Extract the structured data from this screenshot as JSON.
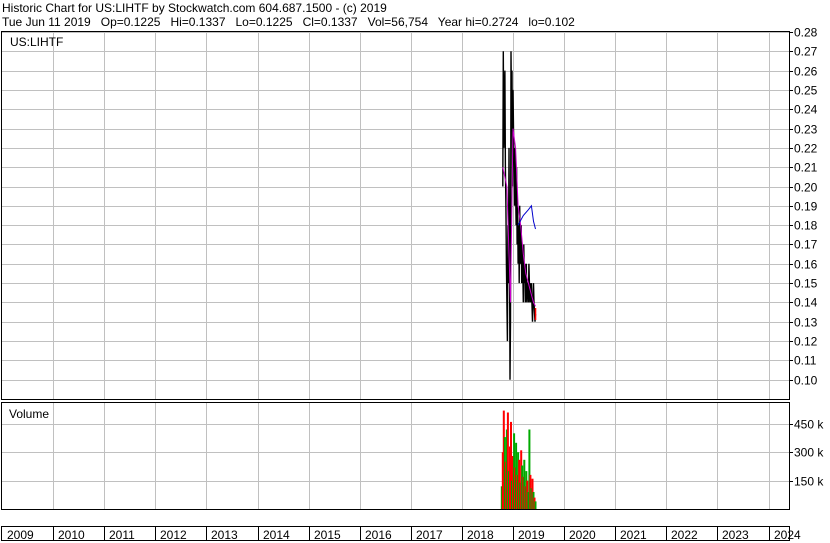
{
  "header": {
    "line1": "Historic Chart for US:LIHTF by Stockwatch.com 604.687.1500 - (c) 2019",
    "line2": "Tue Jun 11 2019   Op=0.1225   Hi=0.1337   Lo=0.1225   Cl=0.1337   Vol=56,754   Year hi=0.2724   lo=0.102"
  },
  "colors": {
    "price": "#000000",
    "ma_fast": "#cc00cc",
    "ma_slow": "#0000cc",
    "vol_up": "#00aa00",
    "vol_down": "#ff0000",
    "grid": "#c0c0c0"
  },
  "chart_data": [
    {
      "type": "line",
      "title": "US:LIHTF",
      "ylim": [
        0.09,
        0.28
      ],
      "y_ticks": [
        "0.28",
        "0.27",
        "0.26",
        "0.25",
        "0.24",
        "0.23",
        "0.22",
        "0.21",
        "0.20",
        "0.19",
        "0.18",
        "0.17",
        "0.16",
        "0.15",
        "0.14",
        "0.13",
        "0.12",
        "0.11",
        "0.10"
      ],
      "x_ticks": [
        "2009",
        "2010",
        "2011",
        "2012",
        "2013",
        "2014",
        "2015",
        "2016",
        "2017",
        "2018",
        "2019",
        "2020",
        "2021",
        "2022",
        "2023",
        "2024"
      ],
      "xlim": [
        2009.0,
        2024.4
      ],
      "series": [
        {
          "role": "price",
          "x": [
            2018.8,
            2018.81,
            2018.82,
            2018.83,
            2018.84,
            2018.85,
            2018.86,
            2018.87,
            2018.88,
            2018.89,
            2018.9,
            2018.91,
            2018.92,
            2018.93,
            2018.94,
            2018.95,
            2018.96,
            2018.97,
            2018.98,
            2018.99,
            2019.0,
            2019.01,
            2019.02,
            2019.03,
            2019.04,
            2019.05,
            2019.06,
            2019.07,
            2019.08,
            2019.09,
            2019.1,
            2019.11,
            2019.12,
            2019.13,
            2019.14,
            2019.15,
            2019.16,
            2019.17,
            2019.18,
            2019.19,
            2019.2,
            2019.21,
            2019.22,
            2019.23,
            2019.24,
            2019.25,
            2019.26,
            2019.27,
            2019.28,
            2019.29,
            2019.3,
            2019.31,
            2019.32,
            2019.33,
            2019.34,
            2019.35,
            2019.36,
            2019.37,
            2019.38,
            2019.39,
            2019.4,
            2019.41,
            2019.42,
            2019.43,
            2019.44
          ],
          "values": [
            0.2,
            0.27,
            0.22,
            0.24,
            0.26,
            0.21,
            0.19,
            0.16,
            0.14,
            0.12,
            0.18,
            0.15,
            0.22,
            0.17,
            0.1,
            0.13,
            0.27,
            0.24,
            0.26,
            0.2,
            0.25,
            0.23,
            0.21,
            0.19,
            0.22,
            0.2,
            0.18,
            0.21,
            0.17,
            0.19,
            0.16,
            0.18,
            0.15,
            0.19,
            0.17,
            0.16,
            0.18,
            0.15,
            0.17,
            0.16,
            0.14,
            0.17,
            0.15,
            0.16,
            0.14,
            0.15,
            0.16,
            0.14,
            0.15,
            0.15,
            0.14,
            0.16,
            0.15,
            0.14,
            0.15,
            0.14,
            0.15,
            0.14,
            0.13,
            0.14,
            0.15,
            0.14,
            0.135,
            0.13,
            0.134
          ]
        },
        {
          "role": "ma_fast",
          "x": [
            2018.8,
            2018.88,
            2018.95,
            2019.0,
            2019.05,
            2019.1,
            2019.15,
            2019.2,
            2019.25,
            2019.3,
            2019.35,
            2019.4,
            2019.44
          ],
          "values": [
            0.21,
            0.2,
            0.14,
            0.23,
            0.22,
            0.19,
            0.18,
            0.165,
            0.155,
            0.15,
            0.145,
            0.14,
            0.138
          ]
        },
        {
          "role": "ma_slow",
          "x": [
            2019.1,
            2019.2,
            2019.3,
            2019.36,
            2019.4,
            2019.44
          ],
          "values": [
            0.18,
            0.185,
            0.188,
            0.19,
            0.182,
            0.178
          ]
        }
      ]
    },
    {
      "type": "bar",
      "title": "Volume",
      "ylim": [
        0,
        560
      ],
      "y_ticks": [
        "450 k",
        "300 k",
        "150 k"
      ],
      "x": [
        2018.78,
        2018.8,
        2018.82,
        2018.84,
        2018.86,
        2018.88,
        2018.9,
        2018.92,
        2018.94,
        2018.96,
        2018.98,
        2019.0,
        2019.02,
        2019.04,
        2019.06,
        2019.08,
        2019.1,
        2019.12,
        2019.14,
        2019.16,
        2019.18,
        2019.2,
        2019.22,
        2019.24,
        2019.26,
        2019.28,
        2019.3,
        2019.32,
        2019.34,
        2019.36,
        2019.38,
        2019.4,
        2019.42,
        2019.44
      ],
      "values": [
        120,
        300,
        520,
        380,
        250,
        420,
        510,
        200,
        330,
        460,
        150,
        280,
        400,
        220,
        350,
        180,
        300,
        260,
        140,
        310,
        230,
        170,
        260,
        120,
        200,
        150,
        90,
        420,
        180,
        110,
        160,
        90,
        60,
        40
      ],
      "direction": [
        "up",
        "down",
        "down",
        "up",
        "down",
        "up",
        "down",
        "up",
        "down",
        "down",
        "up",
        "down",
        "up",
        "down",
        "up",
        "down",
        "up",
        "down",
        "up",
        "down",
        "up",
        "down",
        "up",
        "down",
        "up",
        "down",
        "up",
        "up",
        "down",
        "up",
        "down",
        "up",
        "down",
        "up"
      ]
    }
  ],
  "volume_label": "Volume"
}
